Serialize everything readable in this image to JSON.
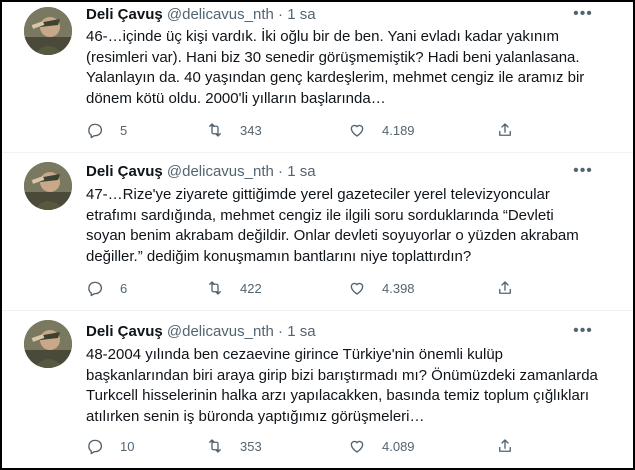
{
  "tweets": [
    {
      "name": "Deli Çavuş",
      "handle": "@delicavus_nth",
      "sep": "·",
      "time": "1 sa",
      "text": "46-…içinde üç kişi vardık. İki oğlu bir de ben. Yani evladı kadar yakınım\n(resimleri var). Hani biz 30 senedir görüşmemiştik? Hadi beni yalanlasana.\nYalanlayın da. 40 yaşından genç kardeşlerim, mehmet cengiz ile aramız bir\ndönem kötü oldu. 2000'li yılların başlarında…",
      "replies": "5",
      "retweets": "343",
      "likes": "4.189"
    },
    {
      "name": "Deli Çavuş",
      "handle": "@delicavus_nth",
      "sep": "·",
      "time": "1 sa",
      "text": "47-…Rize'ye ziyarete gittiğimde yerel gazeteciler yerel televizyoncular\netrafımı sardığında, mehmet cengiz ile ilgili soru sorduklarında “Devleti\nsoyan benim akrabam değildir. Onlar devleti soyuyorlar o yüzden akrabam\ndeğiller.” dediğim konuşmamın bantlarını niye toplattırdın?",
      "replies": "6",
      "retweets": "422",
      "likes": "4.398"
    },
    {
      "name": "Deli Çavuş",
      "handle": "@delicavus_nth",
      "sep": "·",
      "time": "1 sa",
      "text": "48-2004 yılında ben cezaevine girince Türkiye'nin önemli kulüp\nbaşkanlarından biri araya girip bizi barıştırmadı mı? Önümüzdeki zamanlarda\nTurkcell hisselerinin halka arzı yapılacakken, basında temiz toplum çığlıkları\natılırken senin iş büronda yaptığımız görüşmeleri…",
      "replies": "10",
      "retweets": "353",
      "likes": "4.089"
    }
  ],
  "icons": {
    "reply": "reply-icon",
    "retweet": "retweet-icon",
    "like": "heart-icon",
    "share": "share-icon",
    "more": "more-icon"
  },
  "colors": {
    "text": "#0f1419",
    "muted": "#536471",
    "divider": "#eff3f4"
  }
}
